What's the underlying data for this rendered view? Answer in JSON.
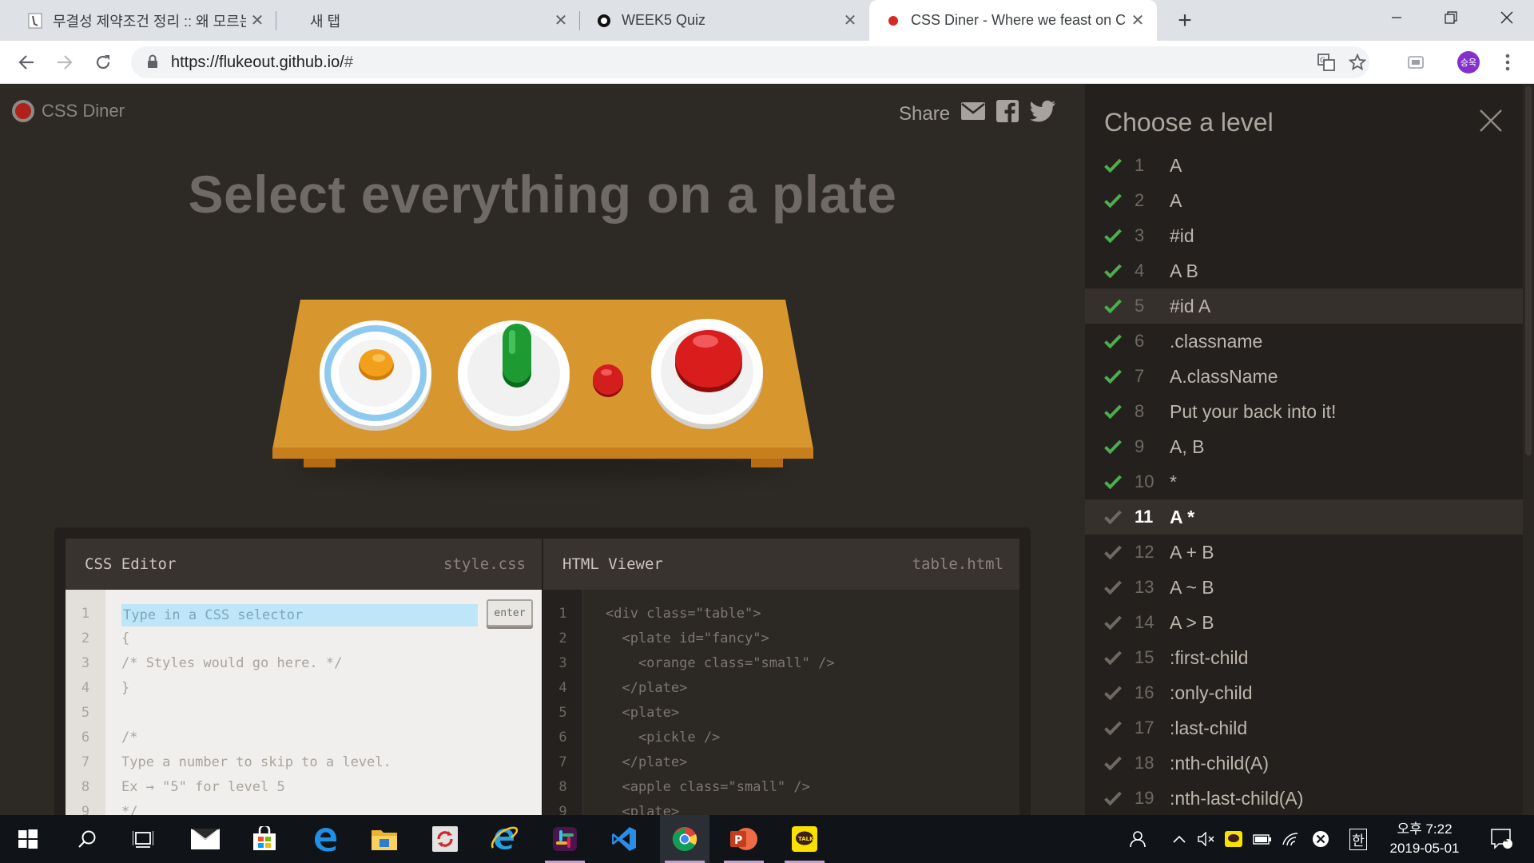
{
  "browser": {
    "tabs": [
      {
        "title": "무결성 제약조건 정리 :: 왜 모르는가",
        "active": false
      },
      {
        "title": "새 탭",
        "active": false
      },
      {
        "title": "WEEK5 Quiz",
        "active": false
      },
      {
        "title": "CSS Diner - Where we feast on CSS Selectors!",
        "active": true
      }
    ],
    "new_tab": "+",
    "url_host": "https://flukeout.github.io/",
    "url_hash": "#",
    "profile_initials": "승욱"
  },
  "header": {
    "brand": "CSS Diner",
    "share_label": "Share"
  },
  "order": "Select everything on a plate",
  "editor": {
    "css_title": "CSS Editor",
    "css_file": "style.css",
    "html_title": "HTML Viewer",
    "html_file": "table.html",
    "input_placeholder": "Type in a CSS selector",
    "enter_label": "enter",
    "css_lines": [
      "",
      "{",
      "/* Styles would go here. */",
      "}",
      "",
      "/*",
      "Type a number to skip to a level.",
      "Ex → \"5\" for level 5",
      "*/"
    ],
    "html_lines": [
      "<div class=\"table\">",
      "  <plate id=\"fancy\">",
      "    <orange class=\"small\" />",
      "  </plate>",
      "  <plate>",
      "    <pickle />",
      "  </plate>",
      "  <apple class=\"small\" />",
      "  <plate>"
    ],
    "line_numbers": [
      "1",
      "2",
      "3",
      "4",
      "5",
      "6",
      "7",
      "8",
      "9"
    ]
  },
  "sidebar": {
    "title": "Choose a level",
    "levels": [
      {
        "num": "1",
        "sel": "A",
        "done": true
      },
      {
        "num": "2",
        "sel": "A",
        "done": true
      },
      {
        "num": "3",
        "sel": "#id",
        "done": true
      },
      {
        "num": "4",
        "sel": "A  B",
        "done": true
      },
      {
        "num": "5",
        "sel": "#id  A",
        "done": true,
        "hover": true
      },
      {
        "num": "6",
        "sel": ".classname",
        "done": true
      },
      {
        "num": "7",
        "sel": "A.className",
        "done": true
      },
      {
        "num": "8",
        "sel": "Put your back into it!",
        "done": true
      },
      {
        "num": "9",
        "sel": "A, B",
        "done": true
      },
      {
        "num": "10",
        "sel": "*",
        "done": true
      },
      {
        "num": "11",
        "sel": "A  *",
        "done": false,
        "current": true
      },
      {
        "num": "12",
        "sel": "A + B",
        "done": false
      },
      {
        "num": "13",
        "sel": "A ~ B",
        "done": false
      },
      {
        "num": "14",
        "sel": "A > B",
        "done": false
      },
      {
        "num": "15",
        "sel": ":first-child",
        "done": false
      },
      {
        "num": "16",
        "sel": ":only-child",
        "done": false
      },
      {
        "num": "17",
        "sel": ":last-child",
        "done": false
      },
      {
        "num": "18",
        "sel": ":nth-child(A)",
        "done": false
      },
      {
        "num": "19",
        "sel": ":nth-last-child(A)",
        "done": false
      }
    ]
  },
  "taskbar": {
    "clock_time": "오후 7:22",
    "clock_date": "2019-05-01",
    "ime": "한",
    "notifications": "1"
  },
  "colors": {
    "check_done": "#4cae4c",
    "check_pending": "#6f6963",
    "page_bg": "#2d2924",
    "sidebar_bg": "#24201d"
  }
}
